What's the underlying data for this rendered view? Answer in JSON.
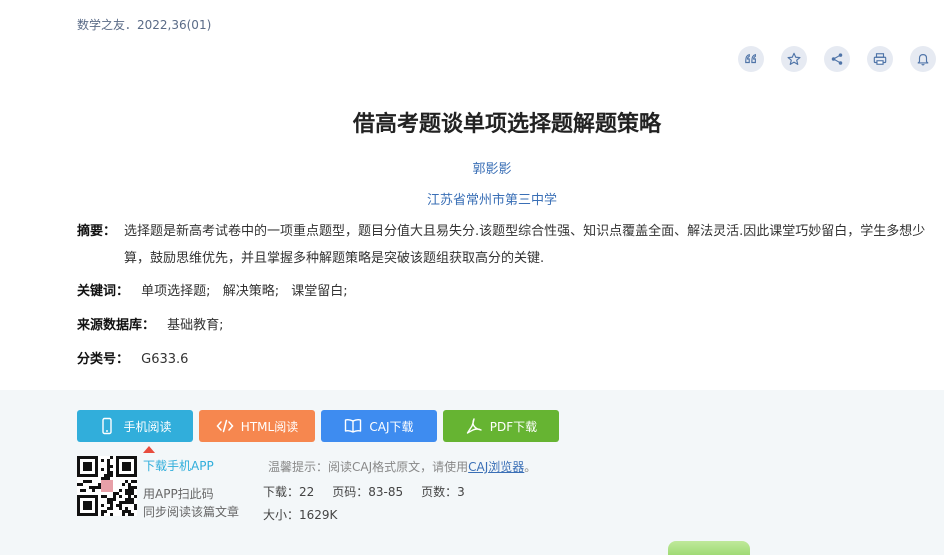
{
  "journal": {
    "citation": "数学之友．2022,36(01)"
  },
  "actions": [
    {
      "name": "quote-icon",
      "glyph": "quote"
    },
    {
      "name": "star-icon",
      "glyph": "star"
    },
    {
      "name": "share-icon",
      "glyph": "share"
    },
    {
      "name": "print-icon",
      "glyph": "print"
    },
    {
      "name": "bell-icon",
      "glyph": "bell"
    }
  ],
  "article": {
    "title": "借高考题谈单项选择题解题策略",
    "author": "郭影影",
    "organization": "江苏省常州市第三中学"
  },
  "abstract": {
    "label": "摘要：",
    "text": "选择题是新高考试卷中的一项重点题型，题目分值大且易失分.该题型综合性强、知识点覆盖全面、解法灵活.因此课堂巧妙留白，学生多想少算，鼓励思维优先，并且掌握多种解题策略是突破该题组获取高分的关键."
  },
  "keywords": {
    "label": "关键词：",
    "items": [
      "单项选择题;",
      "解决策略;",
      "课堂留白;"
    ]
  },
  "source_db": {
    "label": "来源数据库：",
    "value": "基础教育;"
  },
  "classification": {
    "label": "分类号：",
    "value": "G633.6"
  },
  "buttons": {
    "mobile": "手机阅读",
    "html": "HTML阅读",
    "caj": "CAJ下载",
    "pdf": "PDF下载"
  },
  "app": {
    "link": "下载手机APP",
    "line1": "用APP扫此码",
    "line2": "同步阅读该篇文章"
  },
  "tip": {
    "prefix": "温馨提示：阅读CAJ格式原文，请使用",
    "link": "CAJ浏览器",
    "suffix": "。"
  },
  "stats": {
    "downloads": "下载：22",
    "pages_range": "页码：83-85",
    "page_count": "页数：3",
    "size": "大小：1629K"
  },
  "colors": {
    "accent_blue": "#31aedb",
    "orange": "#f6874f",
    "blue": "#3e8cf0",
    "green": "#66b432"
  }
}
